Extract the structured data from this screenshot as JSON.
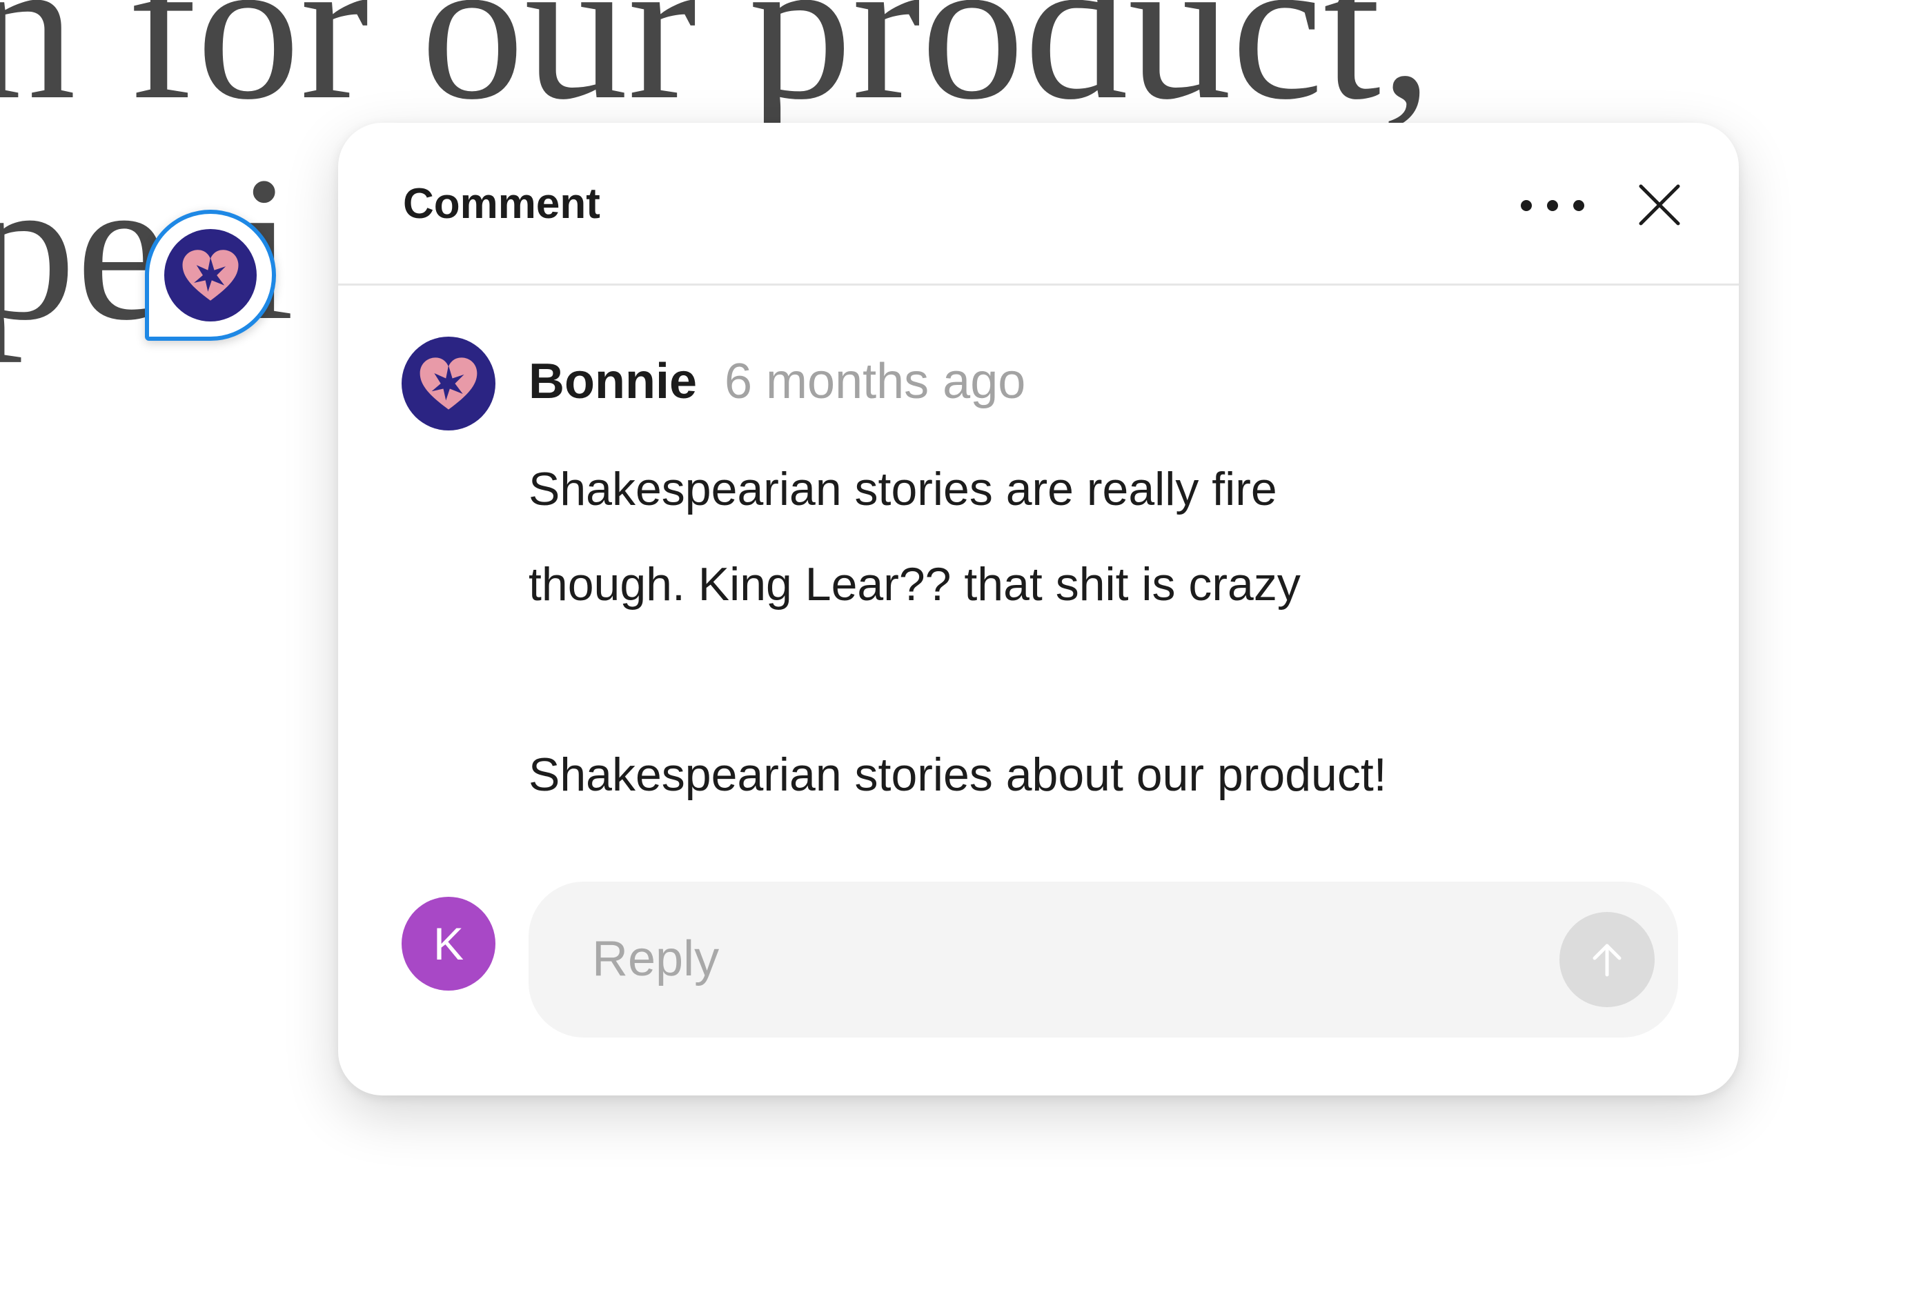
{
  "background": {
    "heading_line_1": "n for our product,",
    "heading_line_2": "peri                                                              on"
  },
  "comment": {
    "title": "Comment",
    "author": "Bonnie",
    "timestamp": "6 months ago",
    "body_line_1": "Shakespearian stories are really fire",
    "body_line_2": "though. King Lear?? that shit is crazy",
    "body_line_3": "Shakespearian stories about our product!",
    "author_avatar_icon": "heart-star-icon",
    "author_avatar_bg": "#2b2483"
  },
  "reply": {
    "avatar_initial": "K",
    "avatar_bg": "#a848c6",
    "placeholder": "Reply",
    "value": ""
  },
  "colors": {
    "pin_border": "#1e88e5",
    "send_button_disabled": "#dcdcdc"
  }
}
